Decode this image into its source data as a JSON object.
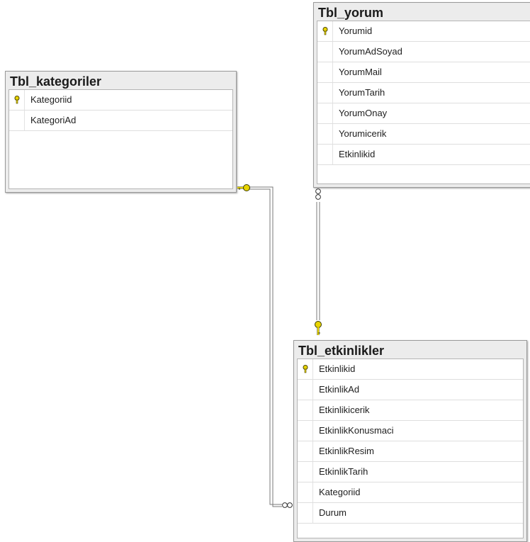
{
  "tables": {
    "kategoriler": {
      "title": "Tbl_kategoriler",
      "columns": [
        {
          "name": "Kategoriid",
          "primary_key": true
        },
        {
          "name": "KategoriAd",
          "primary_key": false
        }
      ]
    },
    "yorum": {
      "title": "Tbl_yorum",
      "columns": [
        {
          "name": "Yorumid",
          "primary_key": true
        },
        {
          "name": "YorumAdSoyad",
          "primary_key": false
        },
        {
          "name": "YorumMail",
          "primary_key": false
        },
        {
          "name": "YorumTarih",
          "primary_key": false
        },
        {
          "name": "YorumOnay",
          "primary_key": false
        },
        {
          "name": "Yorumicerik",
          "primary_key": false
        },
        {
          "name": "Etkinlikid",
          "primary_key": false
        }
      ]
    },
    "etkinlikler": {
      "title": "Tbl_etkinlikler",
      "columns": [
        {
          "name": "Etkinlikid",
          "primary_key": true
        },
        {
          "name": "EtkinlikAd",
          "primary_key": false
        },
        {
          "name": "Etkinlikicerik",
          "primary_key": false
        },
        {
          "name": "EtkinlikKonusmaci",
          "primary_key": false
        },
        {
          "name": "EtkinlikResim",
          "primary_key": false
        },
        {
          "name": "EtkinlikTarih",
          "primary_key": false
        },
        {
          "name": "Kategoriid",
          "primary_key": false
        },
        {
          "name": "Durum",
          "primary_key": false
        }
      ]
    }
  },
  "relationships": [
    {
      "from": "Tbl_kategoriler.Kategoriid",
      "to": "Tbl_etkinlikler.Kategoriid",
      "one_end": "key-icon",
      "many_end": "infinity-icon"
    },
    {
      "from": "Tbl_etkinlikler.Etkinlikid",
      "to": "Tbl_yorum.Etkinlikid",
      "one_end": "key-icon",
      "many_end": "infinity-icon"
    }
  ],
  "colors": {
    "key": "#e8d400",
    "connector": "#7a7a7a",
    "header": "#ececec"
  }
}
